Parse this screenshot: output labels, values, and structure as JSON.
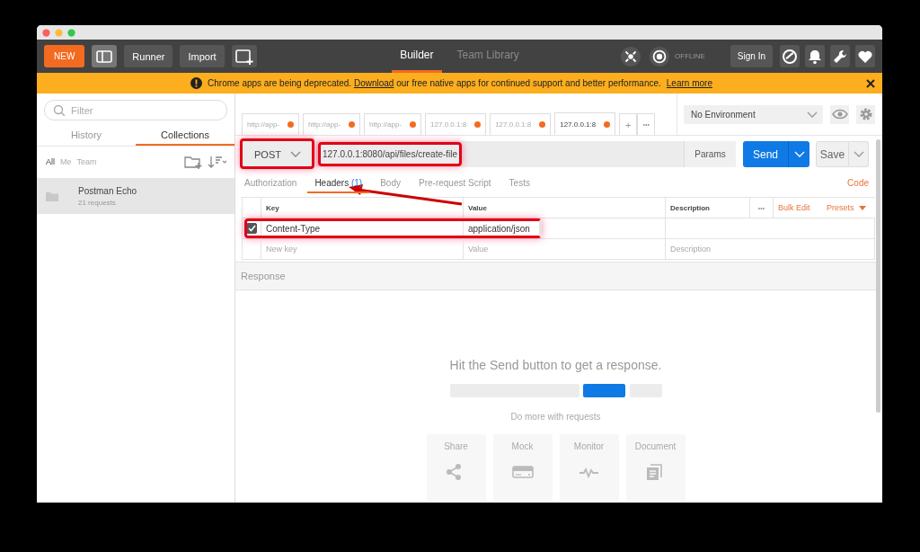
{
  "toolbar": {
    "new_button": "NEW",
    "runner_button": "Runner",
    "import_button": "Import",
    "views": [
      {
        "label": "Builder",
        "selected": true
      },
      {
        "label": "Team Library",
        "selected": false
      }
    ],
    "sync_status": "OFFLINE",
    "sign_in_button": "Sign In"
  },
  "banner": {
    "text_before": "Chrome apps are being deprecated.",
    "link": "Download",
    "text_after": "our free native apps for continued support and better performance.",
    "learn_more": "Learn more"
  },
  "sidebar": {
    "filter_placeholder": "Filter",
    "tabs": [
      {
        "label": "History",
        "selected": false
      },
      {
        "label": "Collections",
        "selected": true
      }
    ],
    "filters": [
      {
        "label": "All",
        "selected": true
      },
      {
        "label": "Me",
        "selected": false
      },
      {
        "label": "Team",
        "selected": false
      }
    ],
    "collections": [
      {
        "name": "Postman Echo",
        "count": "21 requests",
        "selected": true
      }
    ]
  },
  "request_tabs": [
    {
      "label": "http://app-",
      "modified": true,
      "selected": false
    },
    {
      "label": "http://app-",
      "modified": true,
      "selected": false
    },
    {
      "label": "http://app-",
      "modified": true,
      "selected": false
    },
    {
      "label": "127.0.0.1:8",
      "modified": true,
      "selected": false
    },
    {
      "label": "127.0.0.1:8",
      "modified": true,
      "selected": false
    },
    {
      "label": "127.0.0.1:8",
      "modified": true,
      "selected": true
    }
  ],
  "add_tab": "+",
  "tab_menu": "•••",
  "environment": "No Environment",
  "request": {
    "method": "POST",
    "method_highlighted": true,
    "url": "127.0.0.1:8080/api/files/create-file",
    "url_highlighted": true,
    "params_button": "Params",
    "send_button": "Send",
    "save_button": "Save"
  },
  "sub_tabs": [
    {
      "label": "Authorization",
      "selected": false,
      "pointed_at": false
    },
    {
      "label": "Headers",
      "count": "(1)",
      "selected": true,
      "pointed_at": true
    },
    {
      "label": "Body",
      "selected": false,
      "pointed_at": false
    },
    {
      "label": "Pre-request Script",
      "selected": false,
      "pointed_at": false
    },
    {
      "label": "Tests",
      "selected": false,
      "pointed_at": false
    }
  ],
  "code_link": "Code",
  "headers": {
    "columns": [
      "Key",
      "Value",
      "Description"
    ],
    "more": "•••",
    "bulk_edit": "Bulk Edit",
    "presets": "Presets",
    "rows": [
      {
        "checked": true,
        "key": "Content-Type",
        "value": "application/json",
        "highlighted": true
      }
    ],
    "new_row": {
      "key": "New key",
      "value": "Value",
      "description": "Description"
    }
  },
  "response": {
    "title": "Response",
    "empty_message": "Hit the Send button to get a response.",
    "more_title": "Do more with requests",
    "actions": [
      {
        "label": "Share",
        "kind": "share"
      },
      {
        "label": "Mock",
        "kind": "mock"
      },
      {
        "label": "Monitor",
        "kind": "monitor"
      },
      {
        "label": "Document",
        "kind": "document"
      }
    ]
  }
}
